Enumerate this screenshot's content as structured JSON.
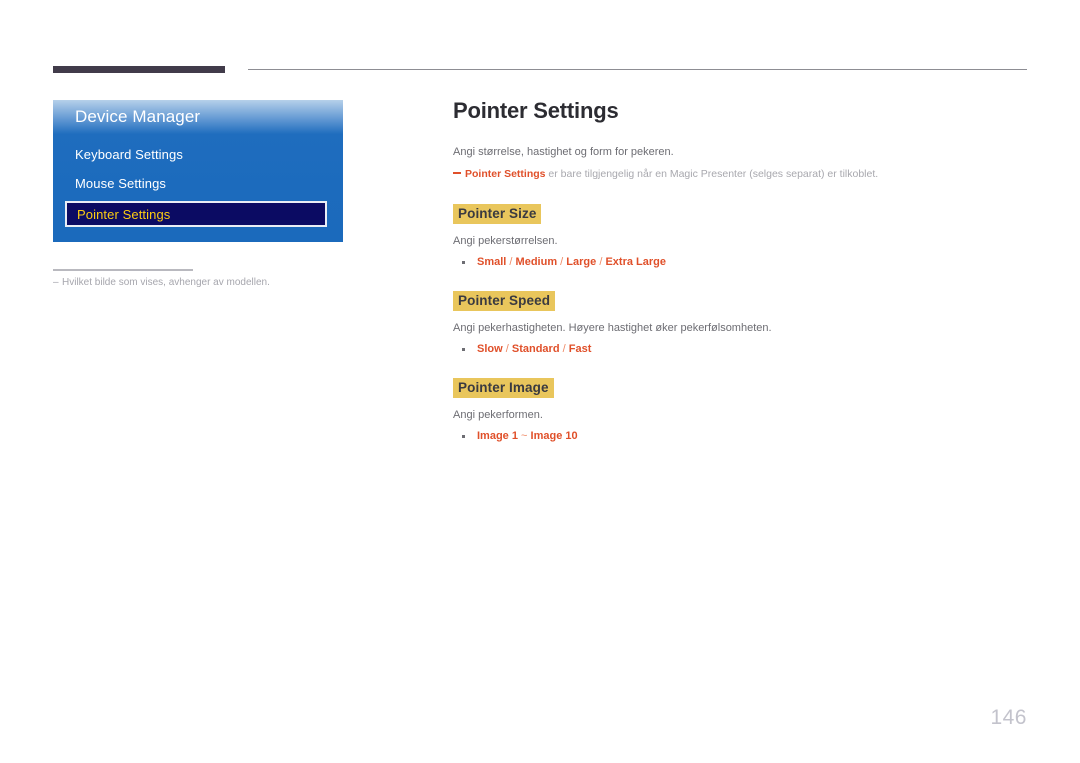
{
  "page": {
    "number": "146"
  },
  "osd": {
    "title": "Device Manager",
    "items": [
      {
        "label": "Keyboard Settings",
        "selected": false
      },
      {
        "label": "Mouse Settings",
        "selected": false
      },
      {
        "label": "Pointer Settings",
        "selected": true
      }
    ],
    "footnote": {
      "dash": "–",
      "text": "Hvilket bilde som vises, avhenger av modellen."
    }
  },
  "content": {
    "title": "Pointer Settings",
    "intro": "Angi størrelse, hastighet og form for pekeren.",
    "note": {
      "bold": "Pointer Settings",
      "rest": " er bare tilgjengelig når en Magic Presenter (selges separat) er tilkoblet."
    },
    "sections": [
      {
        "heading": "Pointer Size",
        "desc": "Angi pekerstørrelsen.",
        "options": "Small / Medium / Large / Extra Large",
        "option_parts": [
          "Small",
          "/",
          "Medium",
          "/",
          "Large",
          "/",
          "Extra Large"
        ]
      },
      {
        "heading": "Pointer Speed",
        "desc": "Angi pekerhastigheten. Høyere hastighet øker pekerfølsomheten.",
        "options": "Slow / Standard / Fast",
        "option_parts": [
          "Slow",
          "/",
          "Standard",
          "/",
          "Fast"
        ]
      },
      {
        "heading": "Pointer Image",
        "desc": "Angi pekerformen.",
        "options": "Image 1 ~ Image 10",
        "option_parts": [
          "Image 1",
          "~",
          "Image 10"
        ]
      }
    ]
  },
  "colors": {
    "accent_orange": "#e0502a",
    "heading_highlight": "#e9c65c",
    "osd_blue": "#1f6dbe",
    "osd_selected_bg": "#0b0b63",
    "osd_selected_text": "#fccc12",
    "top_bar_dark": "#413b4a"
  }
}
